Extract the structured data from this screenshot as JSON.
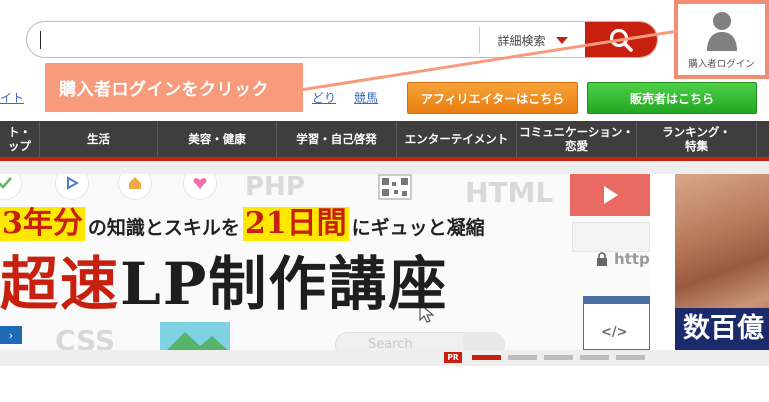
{
  "search": {
    "value": "",
    "detail_label": "詳細検索"
  },
  "login": {
    "label": "購入者ログイン"
  },
  "annotation": {
    "text": "購入者ログインをクリック",
    "color": "#f79b7c"
  },
  "links": {
    "left_fragment": "イト",
    "mid_fragment": "どり",
    "keiba": "競馬"
  },
  "buttons": {
    "affiliate": "アフィリエイターはこちら",
    "seller": "販売者はこちら"
  },
  "nav": {
    "items": [
      {
        "line1": "ト・",
        "line2": "ップ"
      },
      {
        "line1": "生活",
        "line2": ""
      },
      {
        "line1": "美容・健康",
        "line2": ""
      },
      {
        "line1": "学習・自己啓発",
        "line2": ""
      },
      {
        "line1": "エンターテイメント",
        "line2": ""
      },
      {
        "line1": "コミュニケーション・",
        "line2": "恋愛"
      },
      {
        "line1": "ランキング・",
        "line2": "特集"
      },
      {
        "line1": "",
        "line2": ""
      }
    ]
  },
  "banner": {
    "deco_php": "PHP",
    "deco_html": "HTML",
    "deco_https": "https",
    "deco_css": "CSS",
    "deco_code": "</>",
    "line1_a": "3年分",
    "line1_b": "の知識とスキルを",
    "line1_c": "21日間",
    "line1_d": "にギュッと凝縮",
    "title_red": "超速",
    "title_black": "LP制作講座",
    "search_placeholder": "Search",
    "chevron": "›"
  },
  "slider": {
    "pr_label": "PR",
    "dot_count": 5,
    "active_index": 0
  },
  "side_ad": {
    "text": "数百億"
  },
  "colors": {
    "brand_red": "#c8200f",
    "affiliate_orange": "#ea7d10",
    "seller_green": "#22a621",
    "nav_bg": "#3e3e3e",
    "highlight": "#ffe800"
  }
}
